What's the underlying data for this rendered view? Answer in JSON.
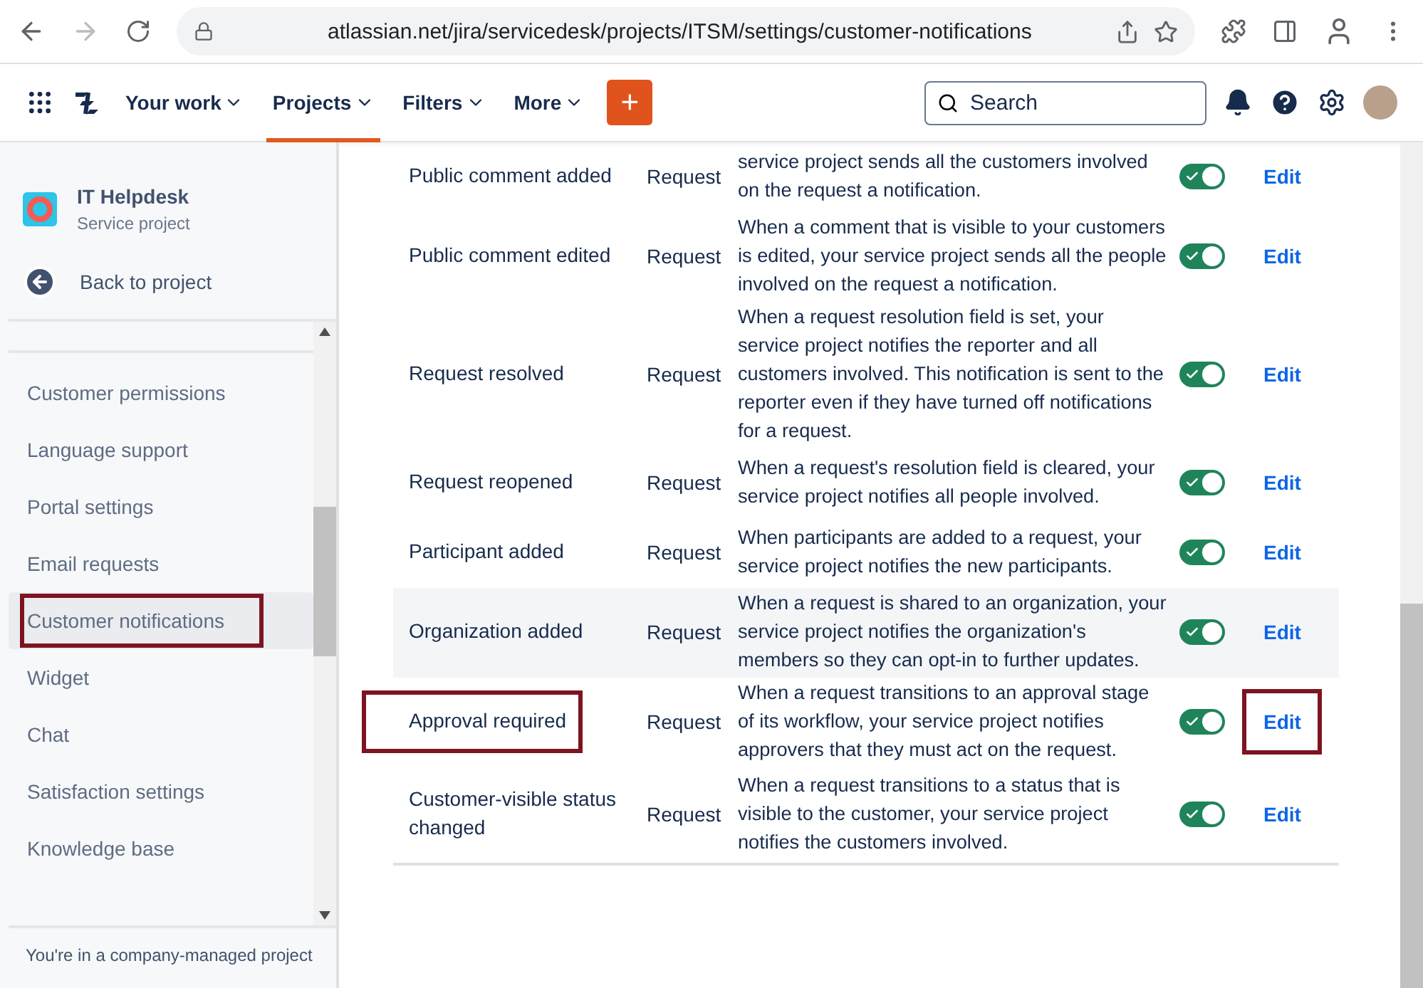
{
  "browser": {
    "url": "atlassian.net/jira/servicedesk/projects/ITSM/settings/customer-notifications"
  },
  "nav": {
    "items": [
      {
        "label": "Your work",
        "selected": false
      },
      {
        "label": "Projects",
        "selected": true
      },
      {
        "label": "Filters",
        "selected": false
      },
      {
        "label": "More",
        "selected": false
      }
    ],
    "create_button": "+",
    "search": {
      "placeholder": "Search"
    }
  },
  "sidebar": {
    "project_name": "IT Helpdesk",
    "project_type": "Service project",
    "back_link": "Back to project",
    "items": [
      {
        "label": "Customer permissions",
        "selected": false,
        "annotated": false
      },
      {
        "label": "Language support",
        "selected": false,
        "annotated": false
      },
      {
        "label": "Portal settings",
        "selected": false,
        "annotated": false
      },
      {
        "label": "Email requests",
        "selected": false,
        "annotated": false
      },
      {
        "label": "Customer notifications",
        "selected": true,
        "annotated": true
      },
      {
        "label": "Widget",
        "selected": false,
        "annotated": false
      },
      {
        "label": "Chat",
        "selected": false,
        "annotated": false
      },
      {
        "label": "Satisfaction settings",
        "selected": false,
        "annotated": false
      },
      {
        "label": "Knowledge base",
        "selected": false,
        "annotated": false
      }
    ],
    "footer": "You're in a company-managed project"
  },
  "notifications": [
    {
      "name": "Public comment added",
      "type": "Request",
      "description": "service project sends all the customers involved on the request a notification.",
      "on": true,
      "action": "Edit",
      "hovered": false,
      "name_annotated": false,
      "action_annotated": false
    },
    {
      "name": "Public comment edited",
      "type": "Request",
      "description": "When a comment that is visible to your customers is edited, your service project sends all the people involved on the request a notification.",
      "on": true,
      "action": "Edit",
      "hovered": false,
      "name_annotated": false,
      "action_annotated": false
    },
    {
      "name": "Request resolved",
      "type": "Request",
      "description": "When a request resolution field is set, your service project notifies the reporter and all customers involved. This notification is sent to the reporter even if they have turned off notifications for a request.",
      "on": true,
      "action": "Edit",
      "hovered": false,
      "name_annotated": false,
      "action_annotated": false
    },
    {
      "name": "Request reopened",
      "type": "Request",
      "description": "When a request's resolution field is cleared, your service project notifies all people involved.",
      "on": true,
      "action": "Edit",
      "hovered": false,
      "name_annotated": false,
      "action_annotated": false
    },
    {
      "name": "Participant added",
      "type": "Request",
      "description": "When participants are added to a request, your service project notifies the new participants.",
      "on": true,
      "action": "Edit",
      "hovered": false,
      "name_annotated": false,
      "action_annotated": false
    },
    {
      "name": "Organization added",
      "type": "Request",
      "description": "When a request is shared to an organization, your service project notifies the organization's members so they can opt-in to further updates.",
      "on": true,
      "action": "Edit",
      "hovered": true,
      "name_annotated": false,
      "action_annotated": false
    },
    {
      "name": "Approval required",
      "type": "Request",
      "description": "When a request transitions to an approval stage of its workflow, your service project notifies approvers that they must act on the request.",
      "on": true,
      "action": "Edit",
      "hovered": false,
      "name_annotated": true,
      "action_annotated": true
    },
    {
      "name": "Customer-visible status changed",
      "type": "Request",
      "description": "When a request transitions to a status that is visible to the customer, your service project notifies the customers involved.",
      "on": true,
      "action": "Edit",
      "hovered": false,
      "name_annotated": false,
      "action_annotated": false
    }
  ]
}
